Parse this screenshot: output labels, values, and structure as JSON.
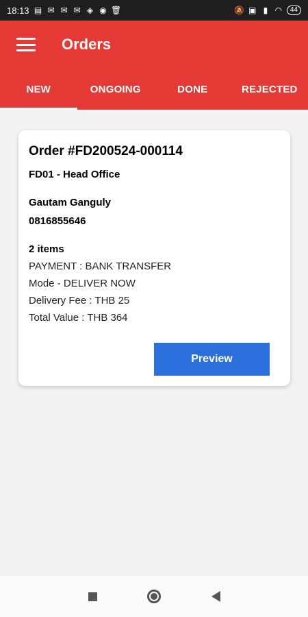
{
  "status_bar": {
    "time": "18:13",
    "battery": "44"
  },
  "app_bar": {
    "title": "Orders",
    "tabs": [
      {
        "label": "NEW",
        "active": true
      },
      {
        "label": "ONGOING",
        "active": false
      },
      {
        "label": "DONE",
        "active": false
      },
      {
        "label": "REJECTED",
        "active": false
      }
    ]
  },
  "order": {
    "id": "Order #FD200524-000114",
    "branch": "FD01 - Head Office",
    "customer_name": "Gautam Ganguly",
    "phone": "0816855646",
    "items": "2 items",
    "payment": "PAYMENT : BANK TRANSFER",
    "mode": "Mode - DELIVER NOW",
    "delivery_fee": "Delivery Fee : THB 25",
    "total_value": "Total Value : THB 364",
    "preview_label": "Preview"
  },
  "colors": {
    "accent": "#e53935",
    "button": "#2a6fdb"
  }
}
